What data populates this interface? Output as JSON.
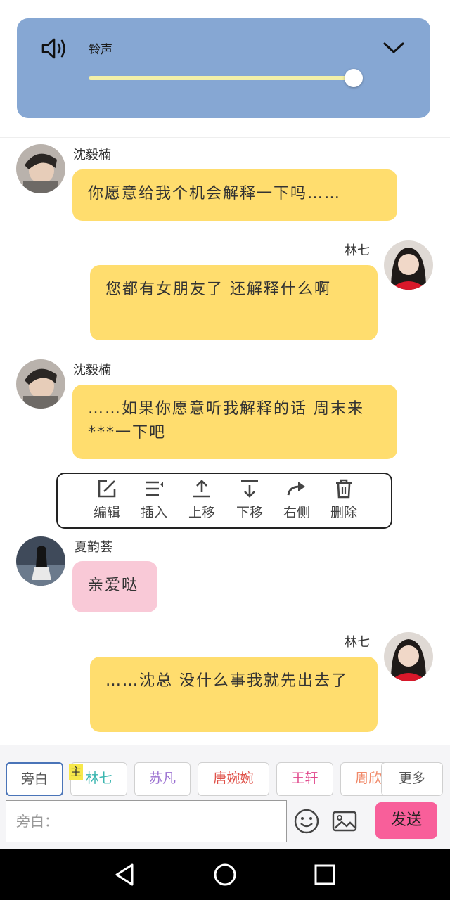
{
  "volume_panel": {
    "label": "铃声",
    "speaker_icon": "speaker-icon",
    "collapse_icon": "chevron-down-icon",
    "level": 0.98
  },
  "messages": [
    {
      "sender": "沈毅楠",
      "side": "left",
      "text": "你愿意给我个机会解释一下吗……",
      "color": "#ffdd6e"
    },
    {
      "sender": "林七",
      "side": "right",
      "text": "您都有女朋友了 还解释什么啊",
      "color": "#ffdd6e"
    },
    {
      "sender": "沈毅楠",
      "side": "left",
      "text": "……如果你愿意听我解释的话 周末来***一下吧",
      "color": "#ffdd6e"
    },
    {
      "sender": "夏韵荟",
      "side": "left",
      "text": "亲爱哒",
      "color": "#f9c9d7"
    },
    {
      "sender": "林七",
      "side": "right",
      "text": "……沈总 没什么事我就先出去了",
      "color": "#ffdd6e"
    }
  ],
  "toolbar": {
    "edit": "编辑",
    "insert": "插入",
    "move_up": "上移",
    "move_down": "下移",
    "right_side": "右侧",
    "delete": "删除"
  },
  "roles": {
    "narration": "旁白",
    "main_badge": "主",
    "r1": "林七",
    "r2": "苏凡",
    "r3": "唐婉婉",
    "r4": "王轩",
    "r5": "周欣",
    "more": "更多"
  },
  "role_colors": {
    "narration": "#555555",
    "r1": "#3bb6b0",
    "r2": "#9a6fd1",
    "r3": "#e0524a",
    "r4": "#e0468a",
    "r5": "#f08a6a",
    "more": "#555555"
  },
  "input": {
    "placeholder": "旁白："
  },
  "actions": {
    "emoji_icon": "emoji-icon",
    "image_icon": "image-icon",
    "send": "发送"
  },
  "colors": {
    "bubble_yellow": "#ffdd6e",
    "bubble_pink": "#f9c9d7",
    "panel_blue": "#86a7d3",
    "send_pink": "#f85f9a"
  }
}
